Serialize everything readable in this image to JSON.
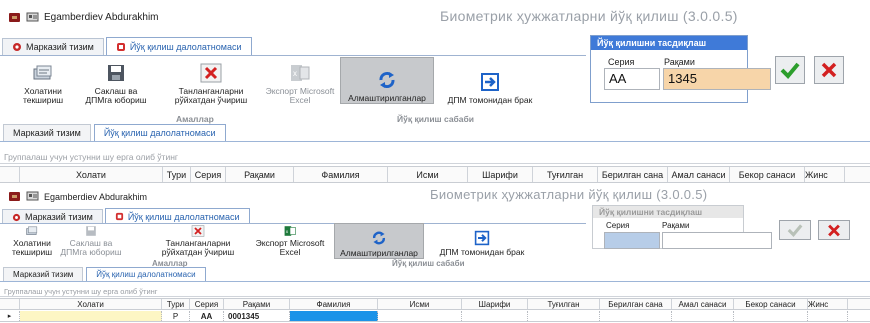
{
  "window": {
    "user": "Egamberdiev Abdurakhim",
    "app_title": "Биометрик ҳужжатларни йўқ қилиш (3.0.0.5)"
  },
  "ribbon": {
    "tabs": [
      "Марказий тизим",
      "Йўқ қилиш далолатномаси"
    ],
    "buttons": {
      "status_check": "Холатини текшириш",
      "save_send": "Саклаш ва ДПМга юбориш",
      "delete_selected": "Танланганларни рўйхатдан ўчириш",
      "export_excel": "Экспорт Microsoft Excel",
      "replaced": "Алмаштирилганлар",
      "dpm_defect": "ДПМ томонидан брак"
    },
    "groups": {
      "actions": "Амаллар",
      "reason": "Йўқ қилиш сабаби"
    }
  },
  "confirm_panel": {
    "title": "Йўқ қилишни тасдиқлаш",
    "series_label": "Серия",
    "number_label": "Рақами",
    "series_value": "AA",
    "number_value": "1345"
  },
  "document_tabs": [
    "Марказий тизим",
    "Йўқ қилиш далолатномаси"
  ],
  "grid": {
    "group_hint": "Группалаш учун устунни шу ерга олиб ўтинг",
    "columns": [
      "Холати",
      "Тури",
      "Серия",
      "Рақами",
      "Фамилия",
      "Исми",
      "Шарифи",
      "Туғилган",
      "Берилган сана",
      "Амал санаси",
      "Бекор санаси",
      "Жинс"
    ],
    "row": {
      "type": "P",
      "series": "AA",
      "number": "0001345"
    }
  },
  "colors": {
    "accent_blue": "#3f7ad8",
    "number_field": "#f7d5a9",
    "row_yellow": "#fdf6c4",
    "row_cyan": "#1b93e8"
  }
}
